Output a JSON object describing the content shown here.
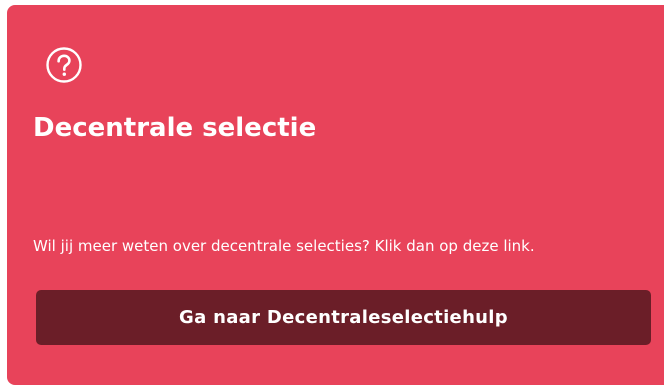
{
  "card": {
    "icon": "question-circle-icon",
    "title": "Decentrale selectie",
    "description": "Wil jij meer weten over decentrale selecties? Klik dan op deze link.",
    "button_label": "Ga naar Decentraleselectiehulp"
  },
  "colors": {
    "card_background": "#e8435a",
    "button_background": "#6b1e28",
    "text": "#ffffff"
  }
}
